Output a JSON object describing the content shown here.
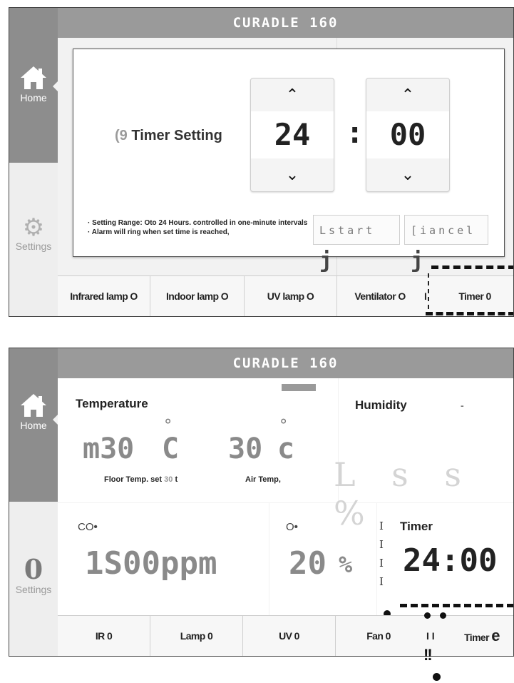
{
  "brand": "CURADLE 160",
  "sidebar": {
    "home_label": "Home",
    "settings_label": "Settings",
    "settings_glyph_alt": "0"
  },
  "screen1": {
    "dialog": {
      "title_prefix": "(9",
      "title": "Timer Setting",
      "hours": "24",
      "colon": ":",
      "minutes": "00",
      "note1": "· Setting Range: Oto 24 Hours. controlled in one-minute intervals",
      "note2": "· Alarm will ring when set time is reached,",
      "start_label": "Lstart",
      "cancel_label": "[iancel",
      "btn_mark": "j"
    },
    "bottombar": [
      {
        "label": "Infrared lamp O"
      },
      {
        "label": "Indoor lamp O"
      },
      {
        "label": "UV lamp O"
      },
      {
        "label": "Ventilator O"
      },
      {
        "label": "Timer 0"
      }
    ],
    "separator_i": "I"
  },
  "screen2": {
    "temperature": {
      "label": "Temperature",
      "floor_value": "m30",
      "floor_unit": "C",
      "air_value": "30",
      "air_unit": "c",
      "deg": "°",
      "floor_label_a": "Floor Temp. set",
      "floor_label_b": "30",
      "floor_label_c": "t",
      "air_label": "Air Temp,"
    },
    "humidity": {
      "label": "Humidity",
      "dash": "-",
      "ghost": "L s s %"
    },
    "co2": {
      "label": "CO",
      "dot": "•",
      "value": "1S00ppm"
    },
    "o2": {
      "label": "O",
      "dot": "•",
      "value": "20",
      "unit": "%"
    },
    "timer": {
      "label": "Timer",
      "value": "24:00",
      "bracket": "I"
    },
    "bottombar": [
      {
        "label": "IR 0"
      },
      {
        "label": "Lamp 0"
      },
      {
        "label": "UV 0"
      },
      {
        "label": "Fan 0"
      },
      {
        "label": "Timer",
        "extra": "e"
      }
    ],
    "separator_i": "I I",
    "marker_glyph": "!!"
  },
  "colors": {
    "titlebar": "#9a9a9a",
    "home_active": "#8d8d8d",
    "value_grey": "#8a8a8a"
  }
}
